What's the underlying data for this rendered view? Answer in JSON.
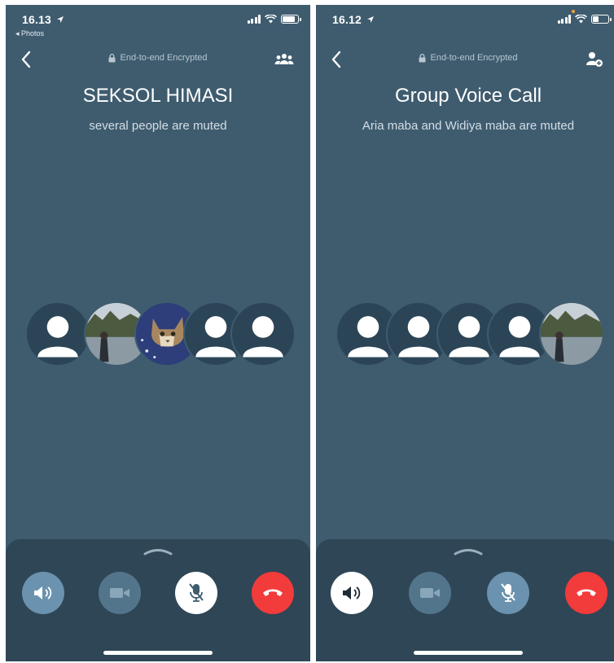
{
  "colors": {
    "screen_bg": "#3f5c6f",
    "panel_bg": "#2f4656",
    "avatar_bg": "#2b4557",
    "end_call_red": "#f23b3b",
    "control_blue": "#6b92ae",
    "control_muted": "#52758c"
  },
  "left_screen": {
    "status": {
      "time": "16.13",
      "back_app": "◂ Photos"
    },
    "header": {
      "encryption": "End-to-end Encrypted",
      "right_icon": "group-icon"
    },
    "call": {
      "title": "SEKSOL HIMASI",
      "subtitle": "several people are muted"
    },
    "participants": [
      {
        "kind": "placeholder"
      },
      {
        "kind": "photo-landscape"
      },
      {
        "kind": "photo-cat"
      },
      {
        "kind": "placeholder"
      },
      {
        "kind": "placeholder"
      }
    ],
    "controls": [
      {
        "name": "speaker",
        "icon": "speaker-icon",
        "state": "off"
      },
      {
        "name": "video",
        "icon": "video-camera-icon",
        "state": "disabled"
      },
      {
        "name": "mute",
        "icon": "mic-off-icon",
        "state": "active"
      },
      {
        "name": "end-call",
        "icon": "phone-hangup-icon",
        "state": "danger"
      }
    ]
  },
  "right_screen": {
    "status": {
      "time": "16.12"
    },
    "header": {
      "encryption": "End-to-end Encrypted",
      "right_icon": "add-person-icon"
    },
    "call": {
      "title": "Group Voice Call",
      "subtitle": "Aria maba and Widiya maba are muted"
    },
    "participants": [
      {
        "kind": "placeholder"
      },
      {
        "kind": "placeholder"
      },
      {
        "kind": "placeholder"
      },
      {
        "kind": "placeholder"
      },
      {
        "kind": "photo-landscape"
      }
    ],
    "controls": [
      {
        "name": "speaker",
        "icon": "speaker-icon",
        "state": "active"
      },
      {
        "name": "video",
        "icon": "video-camera-icon",
        "state": "disabled"
      },
      {
        "name": "mute",
        "icon": "mic-off-icon",
        "state": "off"
      },
      {
        "name": "end-call",
        "icon": "phone-hangup-icon",
        "state": "danger"
      }
    ]
  }
}
